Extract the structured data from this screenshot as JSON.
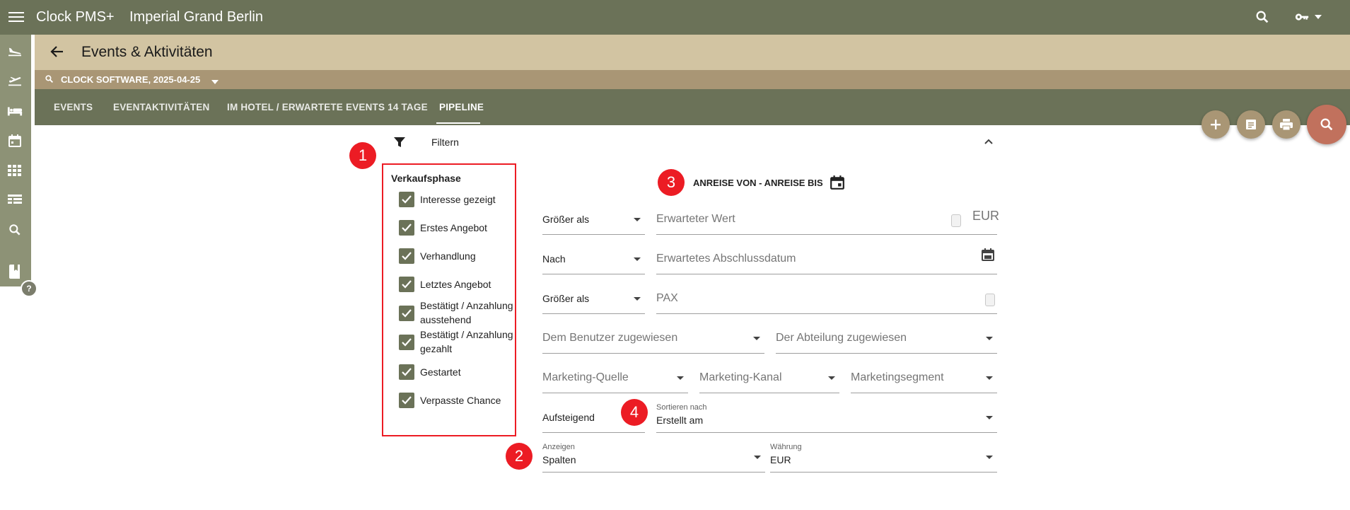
{
  "topbar": {
    "app_name": "Clock PMS+",
    "hotel_name": "Imperial Grand Berlin"
  },
  "titlebar": {
    "title": "Events & Aktivitäten"
  },
  "subbar": {
    "label": "CLOCK SOFTWARE, 2025-04-25"
  },
  "tabs": [
    {
      "label": "EVENTS"
    },
    {
      "label": "EVENTAKTIVITÄTEN"
    },
    {
      "label": "IM HOTEL / ERWARTETE EVENTS 14 TAGE"
    },
    {
      "label": "PIPELINE"
    }
  ],
  "filter": {
    "label": "Filtern"
  },
  "help": {
    "label": "?"
  },
  "badges": [
    "1",
    "2",
    "3",
    "4"
  ],
  "phase": {
    "title": "Verkaufsphase",
    "items": [
      {
        "label": "Interesse gezeigt",
        "checked": true
      },
      {
        "label": "Erstes Angebot",
        "checked": true
      },
      {
        "label": "Verhandlung",
        "checked": true
      },
      {
        "label": "Letztes Angebot",
        "checked": true
      },
      {
        "label": "Bestätigt / Anzahlung ausstehend",
        "checked": true
      },
      {
        "label": "Bestätigt / Anzahlung gezahlt",
        "checked": true
      },
      {
        "label": "Gestartet",
        "checked": true
      },
      {
        "label": "Verpasste Chance",
        "checked": true
      }
    ]
  },
  "range": {
    "label": "ANREISE VON - ANREISE BIS"
  },
  "form": {
    "value_op": "Größer als",
    "value_placeholder": "Erwarteter Wert",
    "currency_suffix": "EUR",
    "date_op": "Nach",
    "date_placeholder": "Erwartetes Abschlussdatum",
    "pax_op": "Größer als",
    "pax_placeholder": "PAX",
    "user_placeholder": "Dem Benutzer zugewiesen",
    "dept_placeholder": "Der Abteilung zugewiesen",
    "source_placeholder": "Marketing-Quelle",
    "channel_placeholder": "Marketing-Kanal",
    "segment_placeholder": "Marketingsegment",
    "order": "Aufsteigend",
    "sort_label": "Sortieren nach",
    "sort_value": "Erstellt am",
    "display_label": "Anzeigen",
    "display_value": "Spalten",
    "currency_label": "Währung",
    "currency_value": "EUR"
  },
  "colors": {
    "primary": "#6b7258",
    "title_bg": "#d2c4a2",
    "subbar_bg": "#a99675",
    "accent": "#c1715d",
    "annotation": "#ec1c24"
  }
}
